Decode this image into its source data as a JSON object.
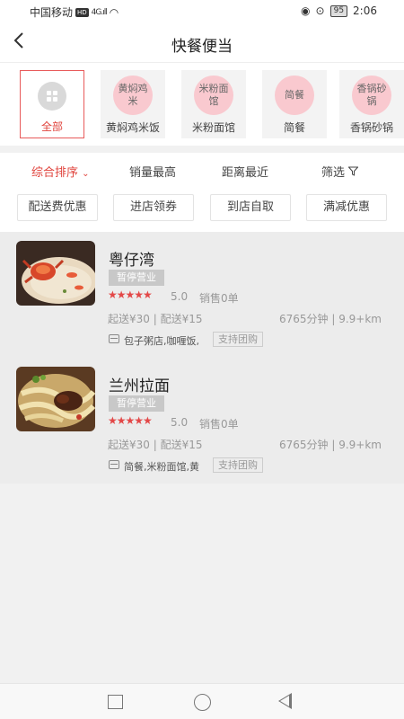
{
  "status_bar": {
    "carrier": "中国移动",
    "hd": "HD",
    "signal": "4G",
    "battery": "95",
    "time": "2:06"
  },
  "header": {
    "back_icon": "back-arrow-icon",
    "title": "快餐便当"
  },
  "categories": [
    {
      "bubble": "",
      "label": "全部",
      "selected": true
    },
    {
      "bubble": "黄焖鸡米",
      "label": "黄焖鸡米饭",
      "selected": false
    },
    {
      "bubble": "米粉面馆",
      "label": "米粉面馆",
      "selected": false
    },
    {
      "bubble": "简餐",
      "label": "简餐",
      "selected": false
    },
    {
      "bubble": "香锅砂锅",
      "label": "香锅砂锅",
      "selected": false
    }
  ],
  "sort_bar": {
    "default": "综合排序",
    "sales": "销量最高",
    "distance": "距离最近",
    "filter": "筛选"
  },
  "filter_chips": [
    "配送费优惠",
    "进店领券",
    "到店自取",
    "满减优惠"
  ],
  "shops": [
    {
      "name": "粤仔湾",
      "status": "暂停营业",
      "stars": "★★★★★",
      "rating": "5.0",
      "sales": "销售0单",
      "fees": "起送¥30 | 配送¥15",
      "distance": "6765分钟 | 9.9+km",
      "tags": "包子粥店,咖喱饭,",
      "group_buy": "支持团购"
    },
    {
      "name": "兰州拉面",
      "status": "暂停营业",
      "stars": "★★★★★",
      "rating": "5.0",
      "sales": "销售0单",
      "fees": "起送¥30 | 配送¥15",
      "distance": "6765分钟 | 9.9+km",
      "tags": "简餐,米粉面馆,黄",
      "group_buy": "支持团购"
    }
  ],
  "colors": {
    "accent": "#e0433c",
    "bubble": "#f9c9cf",
    "closed_badge": "#c8c8c8"
  }
}
